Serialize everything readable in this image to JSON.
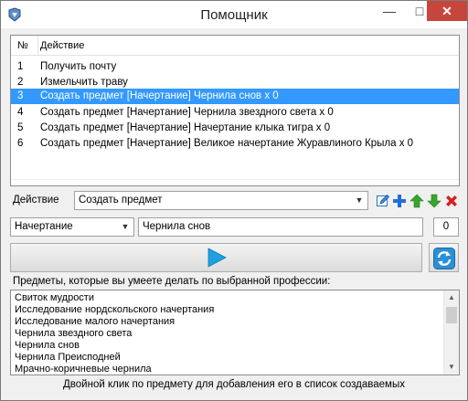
{
  "window": {
    "title": "Помощник"
  },
  "titlebar": {
    "minimize": "—",
    "maximize": "□",
    "close": "✕"
  },
  "actions_list": {
    "columns": [
      "№",
      "Действие"
    ],
    "rows": [
      {
        "num": "1",
        "action": "Получить почту"
      },
      {
        "num": "2",
        "action": "Измельчить траву"
      },
      {
        "num": "3",
        "action": "Создать предмет [Начертание] Чернила снов x 0",
        "selected": true
      },
      {
        "num": "4",
        "action": "Создать предмет [Начертание] Чернила звездного света x 0"
      },
      {
        "num": "5",
        "action": "Создать предмет [Начертание] Начертание клыка тигра x 0"
      },
      {
        "num": "6",
        "action": "Создать предмет [Начертание] Великое начертание Журавлиного Крыла x 0"
      }
    ]
  },
  "action_row": {
    "label": "Действие",
    "selected": "Создать предмет"
  },
  "item_row": {
    "profession": "Начертание",
    "item": "Чернила снов",
    "quantity": "0"
  },
  "items_panel": {
    "caption": "Предметы, которые вы умеете делать по выбранной профессии:",
    "items": [
      "Свиток мудрости",
      "Исследование нордскольского начертания",
      "Исследование малого начертания",
      "Чернила звездного света",
      "Чернила снов",
      "Чернила Преисподней",
      "Мрачно-коричневые чернила"
    ]
  },
  "hint": "Двойной клик по предмету для добавления его в список создаваемых",
  "colors": {
    "selection": "#3399ff",
    "close": "#c7463c",
    "add": "#1f6fd6",
    "up": "#3aa52b",
    "down": "#3aa52b",
    "delete": "#d62020",
    "play": "#1ea0e0"
  },
  "icons": [
    "app-icon",
    "edit-icon",
    "add-icon",
    "move-up-icon",
    "move-down-icon",
    "delete-icon",
    "play-icon",
    "refresh-icon"
  ]
}
